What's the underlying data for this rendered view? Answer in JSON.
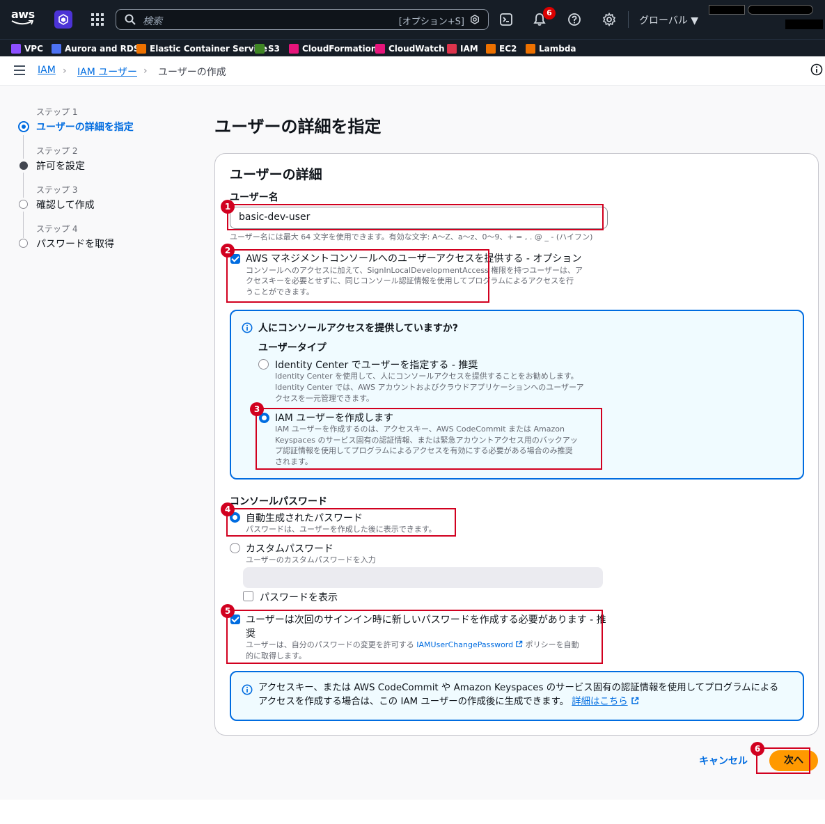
{
  "topnav": {
    "logo": "aws",
    "search_placeholder": "検索",
    "search_shortcut": "[オプション+S]",
    "notification_count": "6",
    "region": "グローバル ▼"
  },
  "favorites": [
    {
      "label": "VPC",
      "color": "#8c4fff"
    },
    {
      "label": "Aurora and RDS",
      "color": "#4d72f3"
    },
    {
      "label": "Elastic Container Service",
      "color": "#ed7100"
    },
    {
      "label": "S3",
      "color": "#3f8624"
    },
    {
      "label": "CloudFormation",
      "color": "#e7157b"
    },
    {
      "label": "CloudWatch",
      "color": "#e7157b"
    },
    {
      "label": "IAM",
      "color": "#dd344c"
    },
    {
      "label": "EC2",
      "color": "#ed7100"
    },
    {
      "label": "Lambda",
      "color": "#ed7100"
    }
  ],
  "breadcrumb": {
    "items": [
      "IAM",
      "IAM ユーザー",
      "ユーザーの作成"
    ]
  },
  "steps": [
    {
      "label": "ステップ 1",
      "name": "ユーザーの詳細を指定"
    },
    {
      "label": "ステップ 2",
      "name": "許可を設定"
    },
    {
      "label": "ステップ 3",
      "name": "確認して作成"
    },
    {
      "label": "ステップ 4",
      "name": "パスワードを取得"
    }
  ],
  "page_title": "ユーザーの詳細を指定",
  "card": {
    "title": "ユーザーの詳細",
    "username_label": "ユーザー名",
    "username_value": "basic-dev-user",
    "username_hint": "ユーザー名には最大 64 文字を使用できます。有効な文字: A〜Z、a〜z、0〜9、+ = , . @ _ - (ハイフン)",
    "console_access": {
      "title": "AWS マネジメントコンソールへのユーザーアクセスを提供する - オプション",
      "desc1": "コンソールへのアクセスに加えて、SignInLocalDevelopmentAccess 権限を持つユーザーは、ア",
      "desc2": "クセスキーを必要とせずに、同じコンソール認証情報を使用してプログラムによるアクセスを行",
      "desc3": "うことができます。",
      "checked": true
    },
    "user_type_box": {
      "title": "人にコンソールアクセスを提供していますか?",
      "group_label": "ユーザータイプ",
      "options": [
        {
          "title": "Identity Center でユーザーを指定する - 推奨",
          "desc1": "Identity Center を使用して、人にコンソールアクセスを提供することをお勧めします。",
          "desc2": "Identity Center では、AWS アカウントおよびクラウドアプリケーションへのユーザーア",
          "desc3": "クセスを一元管理できます。",
          "selected": false
        },
        {
          "title": "IAM ユーザーを作成します",
          "desc1": "IAM ユーザーを作成するのは、アクセスキー、AWS CodeCommit または Amazon",
          "desc2": "Keyspaces のサービス固有の認証情報、または緊急アカウントアクセス用のバックアッ",
          "desc3": "プ認証情報を使用してプログラムによるアクセスを有効にする必要がある場合のみ推奨",
          "desc4": "されます。",
          "selected": true
        }
      ]
    },
    "password": {
      "label": "コンソールパスワード",
      "auto_title": "自動生成されたパスワード",
      "auto_desc": "パスワードは、ユーザーを作成した後に表示できます。",
      "custom_title": "カスタムパスワード",
      "custom_desc": "ユーザーのカスタムパスワードを入力",
      "show_password": "パスワードを表示",
      "reset_title1": "ユーザーは次回のサインイン時に新しいパスワードを作成する必要があります - 推",
      "reset_title2": "奨",
      "reset_desc_pre": "ユーザーは、自分のパスワードの変更を許可する ",
      "reset_desc_link": "IAMUserChangePassword",
      "reset_desc_post": " ポリシーを自動",
      "reset_desc2": "的に取得します。"
    },
    "access_key_info": {
      "line1": "アクセスキー、または AWS CodeCommit や Amazon Keyspaces のサービス固有の認証情報を使用してプログラムによる",
      "line2": "アクセスを作成する場合は、この IAM ユーザーの作成後に生成できます。",
      "link": "詳細はこちら"
    }
  },
  "footer": {
    "cancel": "キャンセル",
    "next": "次へ"
  },
  "annotations": [
    "1",
    "2",
    "3",
    "4",
    "5",
    "6"
  ]
}
